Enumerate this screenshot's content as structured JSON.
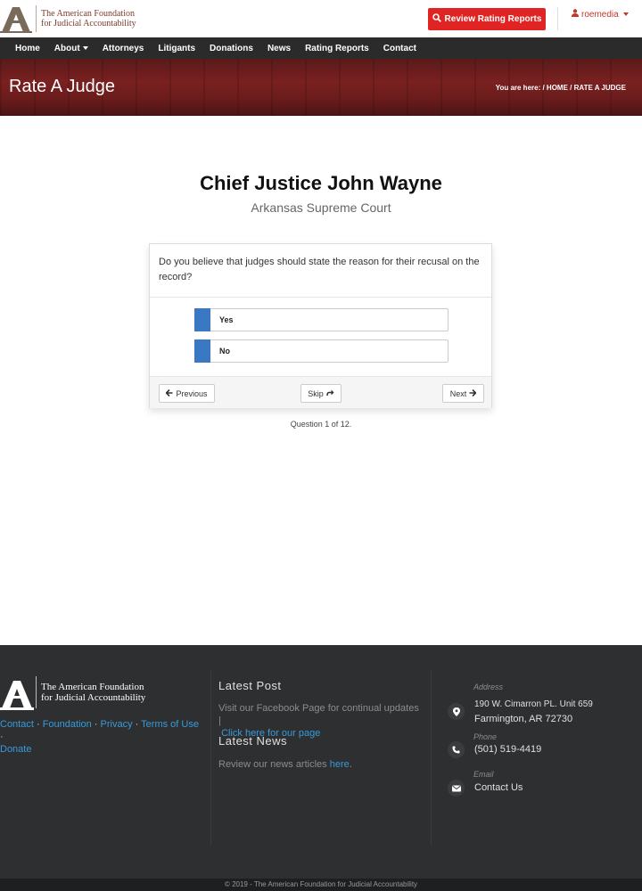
{
  "header": {
    "logo_line1": "The American Foundation",
    "logo_line2": "for Judicial Accountability",
    "review_button": "Review Rating Reports",
    "user": "roemedia"
  },
  "nav": {
    "items": [
      {
        "label": "Home"
      },
      {
        "label": "About",
        "dropdown": true
      },
      {
        "label": "Attorneys"
      },
      {
        "label": "Litigants"
      },
      {
        "label": "Donations"
      },
      {
        "label": "News"
      },
      {
        "label": "Rating Reports"
      },
      {
        "label": "Contact"
      }
    ]
  },
  "banner": {
    "title": "Rate A Judge",
    "breadcrumb_prefix": "You are here:",
    "crumb_home": "/ HOME",
    "crumb_current": "/ RATE A JUDGE"
  },
  "judge": {
    "name": "Chief Justice John Wayne",
    "court": "Arkansas Supreme Court"
  },
  "question": {
    "text": "Do you believe that judges should state the reason for their recusal on the record?",
    "options": [
      {
        "label": "Yes"
      },
      {
        "label": "No"
      }
    ],
    "previous_label": "Previous",
    "skip_label": "Skip",
    "next_label": "Next",
    "progress": "Question 1 of 12."
  },
  "footer": {
    "logo_line1": "The American Foundation",
    "logo_line2": "for Judicial Accountability",
    "links": {
      "contact": "Contact",
      "foundation": "Foundation",
      "privacy": "Privacy",
      "terms": "Terms of Use",
      "donate": "Donate"
    },
    "latest_post_heading": "Latest Post",
    "latest_post_text": "Visit our Facebook Page for continual updates |",
    "latest_post_link": "Click here for our page",
    "latest_news_heading": "Latest News",
    "latest_news_text": "Review our news articles",
    "latest_news_link": "here",
    "address_label": "Address",
    "address_line1": "190 W. Cimarron PL. Unit 659",
    "address_line2": "Farmington, AR 72730",
    "phone_label": "Phone",
    "phone": "(501) 519-4419",
    "email_label": "Email",
    "email_link": "Contact Us",
    "copyright": "© 2019 - The American Foundation for Judicial Accountability"
  },
  "colors": {
    "brand_red": "#e02424",
    "option_blue": "#3a78c3",
    "link_blue": "#3a9ad9",
    "nav_bg": "#2b2b2b",
    "footer_bg": "#2d2f31"
  },
  "icons": {
    "logo": "pillar-logo-icon",
    "review": "search-icon",
    "user": "user-icon",
    "previous": "arrow-left-icon",
    "skip": "share-arrow-icon",
    "next": "arrow-right-icon",
    "address": "map-marker-icon",
    "phone": "phone-icon",
    "email": "envelope-icon"
  }
}
